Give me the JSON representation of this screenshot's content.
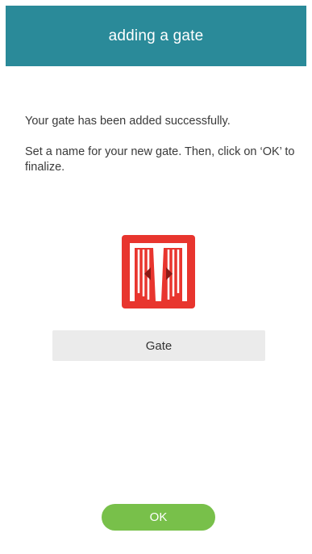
{
  "header": {
    "title": "adding a gate"
  },
  "content": {
    "success_message": "Your gate has been added successfully.",
    "instruction_message": "Set a name for your new gate. Then, click on ‘OK’ to finalize."
  },
  "gate_icon": {
    "icon": "sliding-gate-icon",
    "background_color": "#e8352e"
  },
  "name_field": {
    "value": "Gate"
  },
  "ok_button": {
    "label": "OK",
    "color": "#78c04a"
  },
  "colors": {
    "header": "#2a8a99",
    "accent_green": "#78c04a",
    "icon_red": "#e8352e"
  }
}
